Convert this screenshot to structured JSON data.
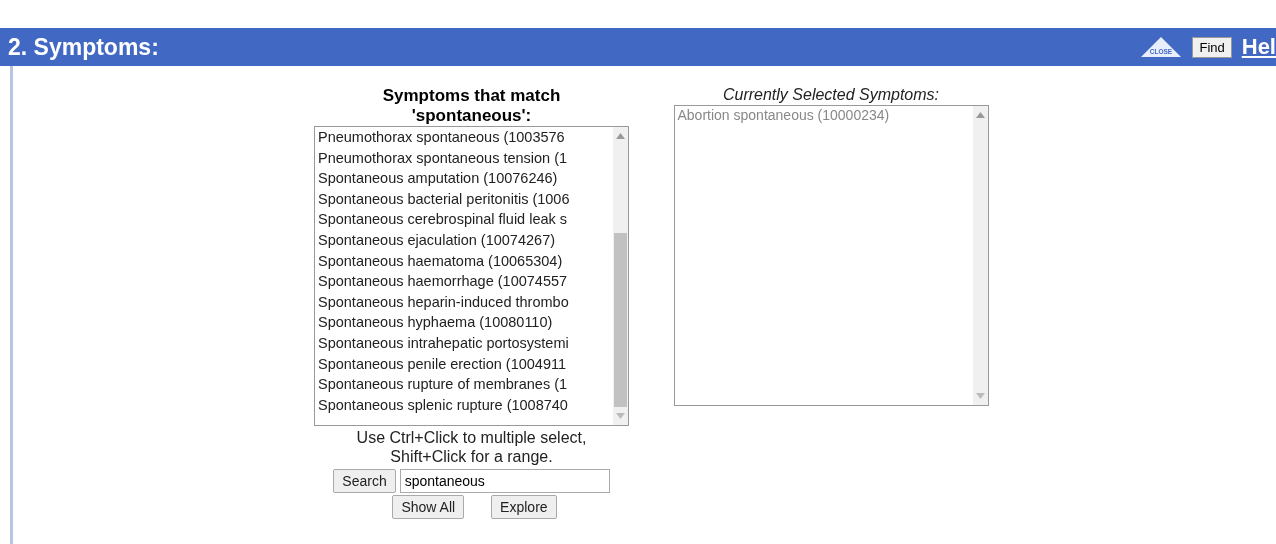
{
  "header": {
    "title": "2. Symptoms:",
    "close_icon_label": "CLOSE",
    "find_button": "Find",
    "help_link": "Hel"
  },
  "matches": {
    "heading_line1": "Symptoms that match",
    "heading_line2": "'spontaneous':",
    "items": [
      {
        "label": "Pneumothorax spontaneous (1003576",
        "selected": false
      },
      {
        "label": "Pneumothorax spontaneous tension (1",
        "selected": false
      },
      {
        "label": "Spontaneous amputation (10076246)",
        "selected": false
      },
      {
        "label": "Spontaneous bacterial peritonitis (1006",
        "selected": false
      },
      {
        "label": "Spontaneous cerebrospinal fluid leak s",
        "selected": false
      },
      {
        "label": "Spontaneous ejaculation (10074267)",
        "selected": false
      },
      {
        "label": "Spontaneous haematoma (10065304)",
        "selected": false
      },
      {
        "label": "Spontaneous haemorrhage (10074557",
        "selected": false
      },
      {
        "label": "Spontaneous heparin-induced thrombo",
        "selected": false
      },
      {
        "label": "Spontaneous hyphaema (10080110)",
        "selected": false
      },
      {
        "label": "Spontaneous intrahepatic portosystemi",
        "selected": false
      },
      {
        "label": "Spontaneous penile erection (1004911",
        "selected": false
      },
      {
        "label": "Spontaneous rupture of membranes (1",
        "selected": false
      },
      {
        "label": "Spontaneous splenic rupture (1008740",
        "selected": false
      }
    ],
    "hint_line1": "Use Ctrl+Click to multiple select,",
    "hint_line2": "Shift+Click for a range.",
    "search_button": "Search",
    "search_value": "spontaneous",
    "show_all_button": "Show All",
    "explore_button": "Explore"
  },
  "selected_symptoms": {
    "heading": "Currently Selected Symptoms:",
    "items": [
      {
        "label": "Abortion spontaneous (10000234)",
        "selected": false
      }
    ]
  }
}
